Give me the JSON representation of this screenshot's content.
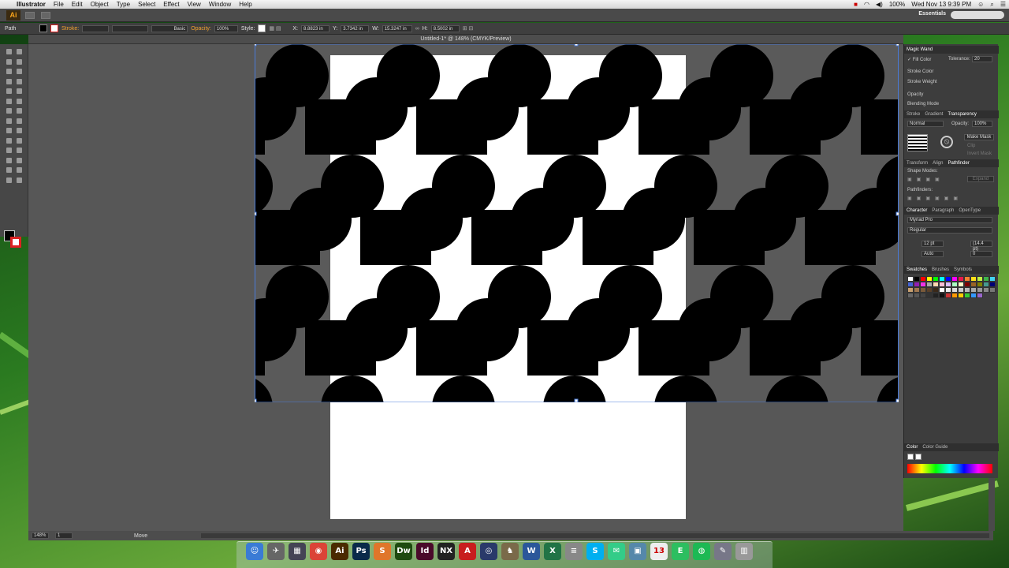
{
  "menubar": {
    "app_name": "Illustrator",
    "items": [
      "File",
      "Edit",
      "Object",
      "Type",
      "Select",
      "Effect",
      "View",
      "Window",
      "Help"
    ],
    "clock": "Wed Nov 13  9:39 PM",
    "battery": "100%"
  },
  "appbar": {
    "logo_text": "Ai",
    "workspace": "Essentials"
  },
  "controlbar": {
    "selection_type": "Path",
    "stroke_label": "Stroke:",
    "brush_label": "Basic",
    "opacity_label": "Opacity:",
    "opacity_value": "100%",
    "style_label": "Style:",
    "x_label": "X:",
    "x_value": "8.8823 in",
    "y_label": "Y:",
    "y_value": "3.7342 in",
    "w_label": "W:",
    "w_value": "15.3247 in",
    "h_label": "H:",
    "h_value": "8.5002 in"
  },
  "document": {
    "tab_title": "Untitled-1* @ 148% (CMYK/Preview)"
  },
  "statusbar": {
    "zoom": "148%",
    "page": "1",
    "tool": "Move"
  },
  "panels": {
    "magic_wand": {
      "title": "Magic Wand",
      "fill_color": "Fill Color",
      "stroke_color": "Stroke Color",
      "stroke_weight": "Stroke Weight",
      "opacity": "Opacity",
      "blending_mode": "Blending Mode",
      "tolerance_label": "Tolerance:",
      "tolerance_value": "20"
    },
    "transparency_tabs": [
      "Stroke",
      "Gradient",
      "Transparency"
    ],
    "transparency": {
      "mode": "Normal",
      "opacity_label": "Opacity:",
      "opacity_value": "100%",
      "make_mask": "Make Mask",
      "clip": "Clip",
      "invert_mask": "Invert Mask"
    },
    "pathfinder_tabs": [
      "Transform",
      "Align",
      "Pathfinder"
    ],
    "pathfinder": {
      "shape_modes": "Shape Modes:",
      "pathfinders": "Pathfinders:",
      "expand": "Expand"
    },
    "character_tabs": [
      "Character",
      "Paragraph",
      "OpenType"
    ],
    "character": {
      "font": "Myriad Pro",
      "style": "Regular",
      "size": "12 pt",
      "leading": "(14.4 pt)",
      "kerning": "Auto",
      "tracking": "0"
    },
    "swatch_tabs": [
      "Swatches",
      "Brushes",
      "Symbols"
    ],
    "color_tabs": [
      "Color",
      "Color Guide"
    ]
  },
  "colors": {
    "pasteboard": "#575757",
    "artboard": "#ffffff",
    "shape_fill": "#000000",
    "selection": "#4a7bd8",
    "accent": "#f7a21b"
  },
  "swatches": [
    "#ffffff",
    "#000000",
    "#ff0000",
    "#ffff00",
    "#00ff00",
    "#00ffff",
    "#0000ff",
    "#ff00ff",
    "#e6194b",
    "#f58231",
    "#ffe119",
    "#bfef45",
    "#3cb44b",
    "#42d4f4",
    "#4363d8",
    "#911eb4",
    "#f032e6",
    "#a9a9a9",
    "#ffd8b1",
    "#fabed4",
    "#dcbeff",
    "#aaffc3",
    "#fffac8",
    "#800000",
    "#9a6324",
    "#808000",
    "#469990",
    "#000075",
    "#c8a070",
    "#a07850",
    "#7a5a3a",
    "#5a4028",
    "#3a2818",
    "#ffffff",
    "#eeeeee",
    "#dddddd",
    "#cccccc",
    "#bbbbbb",
    "#aaaaaa",
    "#999999",
    "#888888",
    "#777777",
    "#666666",
    "#555555",
    "#444444",
    "#333333",
    "#222222",
    "#111111",
    "#cc3333",
    "#ff9900",
    "#ffcc00",
    "#33cc33",
    "#3399ff",
    "#9966cc"
  ],
  "dock_apps": [
    {
      "name": "finder",
      "glyph": "☺",
      "color": "#3a7bd5"
    },
    {
      "name": "launchpad",
      "glyph": "✈",
      "color": "#666"
    },
    {
      "name": "mission-control",
      "glyph": "▦",
      "color": "#445"
    },
    {
      "name": "chrome",
      "glyph": "◉",
      "color": "#db4437"
    },
    {
      "name": "illustrator",
      "glyph": "Ai",
      "color": "#4a2a00"
    },
    {
      "name": "photoshop",
      "glyph": "Ps",
      "color": "#0a2a4a"
    },
    {
      "name": "sublime",
      "glyph": "S",
      "color": "#e0762a"
    },
    {
      "name": "dreamweaver",
      "glyph": "Dw",
      "color": "#1e4a10"
    },
    {
      "name": "indesign",
      "glyph": "Id",
      "color": "#4a0a2a"
    },
    {
      "name": "nx",
      "glyph": "NX",
      "color": "#222"
    },
    {
      "name": "acrobat",
      "glyph": "A",
      "color": "#c81e1e"
    },
    {
      "name": "cinema4d",
      "glyph": "◎",
      "color": "#2a3a6a"
    },
    {
      "name": "cat",
      "glyph": "♞",
      "color": "#7a6a4a"
    },
    {
      "name": "word",
      "glyph": "W",
      "color": "#2b579a"
    },
    {
      "name": "excel",
      "glyph": "X",
      "color": "#217346"
    },
    {
      "name": "calculator",
      "glyph": "≡",
      "color": "#888"
    },
    {
      "name": "skype",
      "glyph": "S",
      "color": "#00aff0"
    },
    {
      "name": "messages",
      "glyph": "✉",
      "color": "#3c8"
    },
    {
      "name": "preview",
      "glyph": "▣",
      "color": "#5588aa"
    },
    {
      "name": "calendar",
      "glyph": "13",
      "color": "#eee"
    },
    {
      "name": "evernote",
      "glyph": "E",
      "color": "#2dbe60"
    },
    {
      "name": "spotify",
      "glyph": "◍",
      "color": "#1db954"
    },
    {
      "name": "scripts",
      "glyph": "✎",
      "color": "#778"
    },
    {
      "name": "trash",
      "glyph": "▥",
      "color": "#999"
    }
  ]
}
